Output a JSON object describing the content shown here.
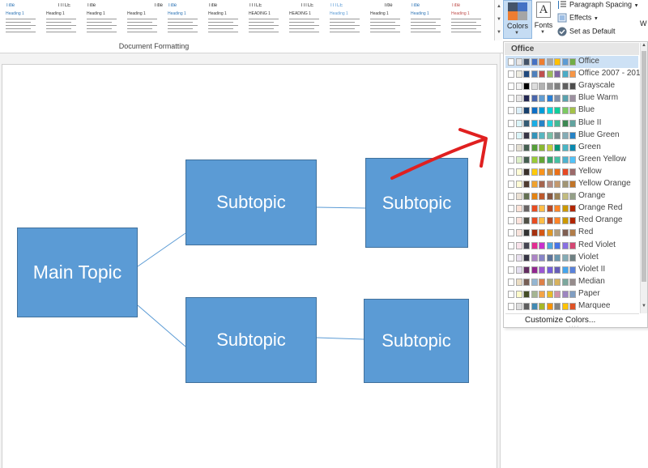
{
  "ribbon": {
    "gallery_group_label": "Document Formatting",
    "style_thumbnails": [
      {
        "title": "Title",
        "heading": "Heading 1",
        "title_color": "#2e74b5",
        "align": "left"
      },
      {
        "title": "TITLE",
        "heading": "Heading 1",
        "title_color": "#333333",
        "align": "center"
      },
      {
        "title": "Title",
        "heading": "Heading 1",
        "title_color": "#333333",
        "align": "left"
      },
      {
        "title": "Title",
        "heading": "Heading 1",
        "title_color": "#333333",
        "align": "right"
      },
      {
        "title": "Title",
        "heading": "Heading 1",
        "title_color": "#2e74b5",
        "align": "left"
      },
      {
        "title": "Title",
        "heading": "Heading 1",
        "title_color": "#333333",
        "align": "left"
      },
      {
        "title": "TITLE",
        "heading": "HEADING 1",
        "title_color": "#333333",
        "align": "left"
      },
      {
        "title": "TITLE",
        "heading": "HEADING 1",
        "title_color": "#333333",
        "align": "center"
      },
      {
        "title": "TITLE",
        "heading": "Heading 1",
        "title_color": "#5b9bd5",
        "align": "left"
      },
      {
        "title": "Title",
        "heading": "Heading 1",
        "title_color": "#333333",
        "align": "center"
      },
      {
        "title": "Title",
        "heading": "Heading 1",
        "title_color": "#2e74b5",
        "align": "left"
      },
      {
        "title": "Title",
        "heading": "Heading 1",
        "title_color": "#c0504d",
        "align": "left"
      }
    ],
    "colors_label": "Colors",
    "fonts_label": "Fonts",
    "fonts_icon_glyph": "A",
    "paragraph_spacing_label": "Paragraph Spacing",
    "effects_label": "Effects",
    "set_as_default_label": "Set as Default",
    "right_clip_label": "W"
  },
  "diagram": {
    "main_topic": "Main Topic",
    "subtopics": [
      "Subtopic",
      "Subtopic",
      "Subtopic",
      "Subtopic"
    ],
    "fill_color": "#5b9bd5",
    "border_color": "#41719c",
    "connector_color": "#5b9bd5"
  },
  "annotation": {
    "arrow_color": "#e02020"
  },
  "colors_dropdown": {
    "header": "Office",
    "customize_label": "Customize Colors...",
    "selected_index": 0,
    "themes": [
      {
        "name": "Office",
        "colors": [
          "#ffffff",
          "#e7e6e6",
          "#44546a",
          "#4472c4",
          "#ed7d31",
          "#a5a5a5",
          "#ffc000",
          "#5b9bd5",
          "#70ad47"
        ]
      },
      {
        "name": "Office 2007 - 2010",
        "colors": [
          "#ffffff",
          "#eeece1",
          "#1f497d",
          "#4f81bd",
          "#c0504d",
          "#9bbb59",
          "#8064a2",
          "#4bacc6",
          "#f79646"
        ]
      },
      {
        "name": "Grayscale",
        "colors": [
          "#ffffff",
          "#f2f2f2",
          "#000000",
          "#dddddd",
          "#b2b2b2",
          "#969696",
          "#808080",
          "#5f5f5f",
          "#4d4d4d"
        ]
      },
      {
        "name": "Blue Warm",
        "colors": [
          "#ffffff",
          "#e7e6e6",
          "#242852",
          "#4a66ac",
          "#629dd1",
          "#297fd5",
          "#7f8fa9",
          "#5aa2ae",
          "#9d90a0"
        ]
      },
      {
        "name": "Blue",
        "colors": [
          "#ffffff",
          "#dbeff9",
          "#17406d",
          "#0f6fc6",
          "#009dd9",
          "#0bd0d9",
          "#10cf9b",
          "#7cca62",
          "#a5c249"
        ]
      },
      {
        "name": "Blue II",
        "colors": [
          "#ffffff",
          "#dbf5f9",
          "#335b74",
          "#1cade4",
          "#2683c6",
          "#27ced7",
          "#42ba97",
          "#3e8853",
          "#62a39f"
        ]
      },
      {
        "name": "Blue Green",
        "colors": [
          "#ffffff",
          "#dbf5f9",
          "#373545",
          "#3494ba",
          "#58b6c0",
          "#75bda7",
          "#7a8c8e",
          "#84acb6",
          "#2683c6"
        ]
      },
      {
        "name": "Green",
        "colors": [
          "#ffffff",
          "#e3ded1",
          "#455f51",
          "#549e39",
          "#8ab833",
          "#c0cf3a",
          "#029676",
          "#4ab5c4",
          "#0989b1"
        ]
      },
      {
        "name": "Green Yellow",
        "colors": [
          "#ffffff",
          "#dbefc6",
          "#455f51",
          "#99cb38",
          "#63a537",
          "#37a76f",
          "#44c1a3",
          "#4eb3cf",
          "#51c3f9"
        ]
      },
      {
        "name": "Yellow",
        "colors": [
          "#ffffff",
          "#fffcd5",
          "#39302a",
          "#ffca08",
          "#f8931d",
          "#ce8d3e",
          "#ec7016",
          "#e64823",
          "#9c6a6a"
        ]
      },
      {
        "name": "Yellow Orange",
        "colors": [
          "#ffffff",
          "#fffbd5",
          "#4e3b30",
          "#f0a22e",
          "#a5644e",
          "#b58b80",
          "#c3986d",
          "#a19574",
          "#c17529"
        ]
      },
      {
        "name": "Orange",
        "colors": [
          "#ffffff",
          "#ebe1d4",
          "#637052",
          "#e48312",
          "#bd582c",
          "#865640",
          "#9b8357",
          "#c2bc80",
          "#94a088"
        ]
      },
      {
        "name": "Orange Red",
        "colors": [
          "#ffffff",
          "#fbe2d7",
          "#696464",
          "#e84c22",
          "#ffbd47",
          "#b64926",
          "#ff8427",
          "#cc9900",
          "#b22600"
        ]
      },
      {
        "name": "Red Orange",
        "colors": [
          "#ffffff",
          "#fde3dc",
          "#505046",
          "#e84c22",
          "#ffbd47",
          "#b64926",
          "#ff8427",
          "#cc9900",
          "#b22600"
        ]
      },
      {
        "name": "Red",
        "colors": [
          "#ffffff",
          "#f8e3dc",
          "#323232",
          "#a5300f",
          "#d55816",
          "#e19825",
          "#b19c7d",
          "#7f5f52",
          "#b27d49"
        ]
      },
      {
        "name": "Red Violet",
        "colors": [
          "#ffffff",
          "#f9e3eb",
          "#454551",
          "#e32d91",
          "#c830cc",
          "#4ea6dc",
          "#4775e7",
          "#8971e1",
          "#d54773"
        ]
      },
      {
        "name": "Violet",
        "colors": [
          "#ffffff",
          "#e8dfee",
          "#373545",
          "#ad84c6",
          "#8784c7",
          "#5d739a",
          "#6997af",
          "#84acb6",
          "#6f8183"
        ]
      },
      {
        "name": "Violet II",
        "colors": [
          "#ffffff",
          "#e4dff0",
          "#632e62",
          "#92278f",
          "#9b57d3",
          "#755dd9",
          "#665eb8",
          "#45a5ed",
          "#5982db"
        ]
      },
      {
        "name": "Median",
        "colors": [
          "#ffffff",
          "#ebddc3",
          "#775f55",
          "#94b6d2",
          "#dd8047",
          "#a5ab81",
          "#d8b25c",
          "#7ba79d",
          "#968c8c"
        ]
      },
      {
        "name": "Paper",
        "colors": [
          "#ffffff",
          "#fefac9",
          "#444d26",
          "#a5b592",
          "#f3a447",
          "#e7bc29",
          "#d092a7",
          "#9c85c0",
          "#809ec2"
        ]
      },
      {
        "name": "Marquee",
        "colors": [
          "#ffffff",
          "#ddddde",
          "#5e5e5e",
          "#418ab3",
          "#a6b727",
          "#f69200",
          "#838383",
          "#fec306",
          "#df5327"
        ]
      }
    ]
  }
}
